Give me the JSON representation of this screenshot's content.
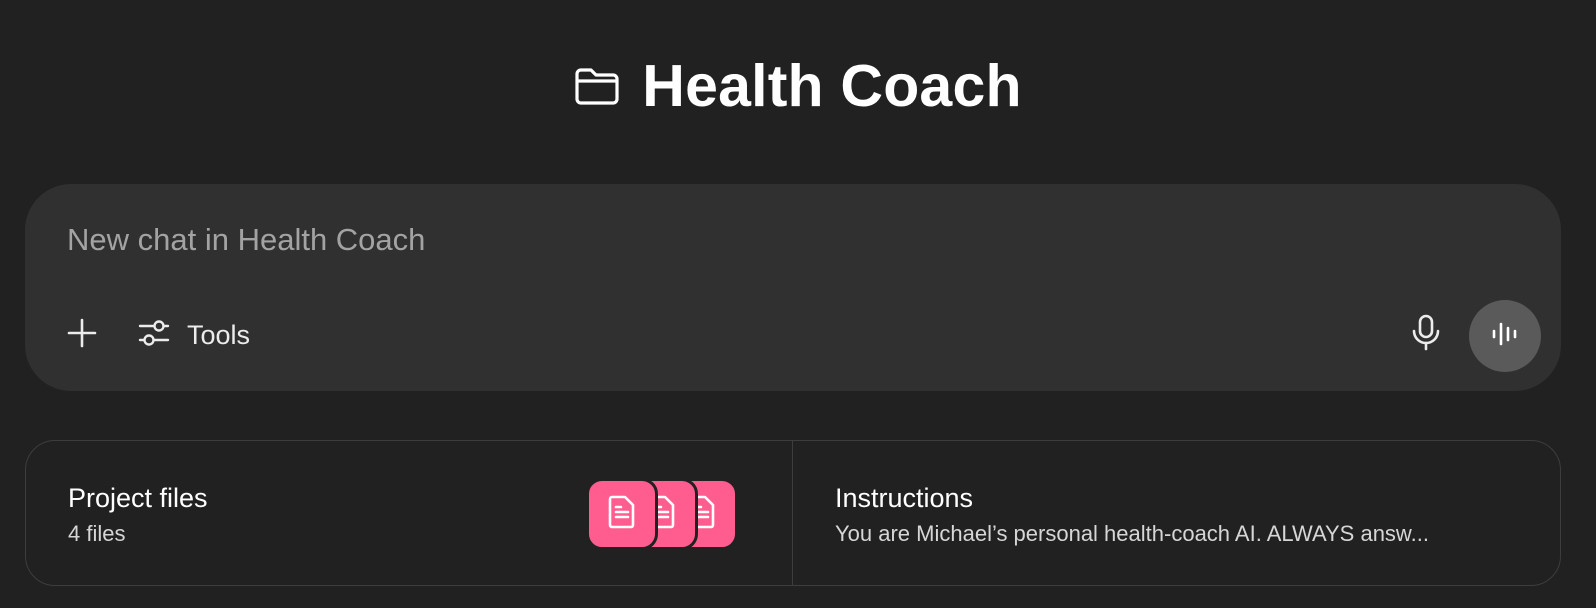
{
  "header": {
    "title": "Health Coach",
    "icon": "folder-icon"
  },
  "composer": {
    "placeholder": "New chat in Health Coach",
    "plus_icon": "plus-icon",
    "tools_label": "Tools",
    "tools_icon": "sliders-icon",
    "mic_icon": "microphone-icon",
    "voice_icon": "voice-waveform-icon"
  },
  "project_files": {
    "title": "Project files",
    "count_label": "4 files",
    "icon": "document-icon",
    "accent_color": "#ff5c8f"
  },
  "instructions": {
    "title": "Instructions",
    "preview": "You are Michael’s personal health-coach AI. ALWAYS answ..."
  },
  "colors": {
    "background": "#212121",
    "composer_bg": "#303030",
    "voice_button_bg": "#5a5a5a"
  }
}
